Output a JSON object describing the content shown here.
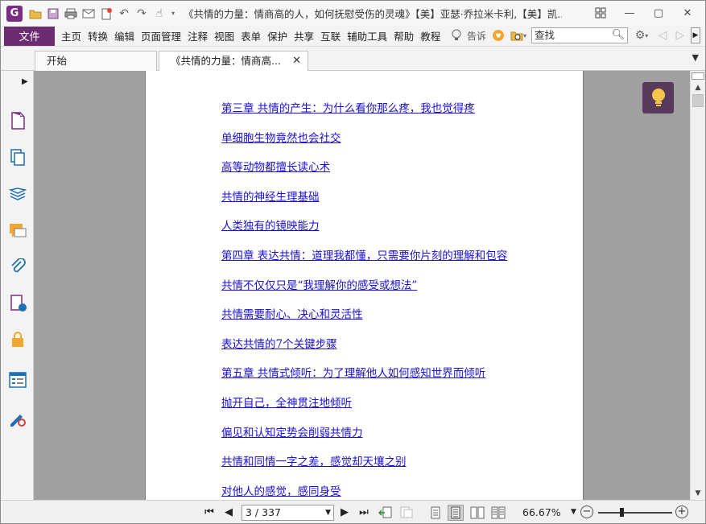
{
  "titlebar": {
    "title": "《共情的力量：情商高的人，如何抚慰受伤的灵魂》【美】亚瑟·乔拉米卡利,【美】凯...",
    "logo_letter": "G",
    "quick_access_icons": [
      "open-icon",
      "save-icon",
      "print-icon",
      "email-icon",
      "new-icon",
      "undo-icon",
      "redo-icon",
      "hand-tool-icon"
    ]
  },
  "menubar": {
    "file_label": "文件",
    "items": [
      "主页",
      "转换",
      "编辑",
      "页面管理",
      "注释",
      "视图",
      "表单",
      "保护",
      "共享",
      "互联",
      "辅助工具",
      "帮助",
      "教程"
    ],
    "tell_label": "告诉",
    "search_placeholder": "查找"
  },
  "tabs": [
    {
      "label": "开始",
      "active": false
    },
    {
      "label": "《共情的力量：情商高...",
      "active": true,
      "close": "✕"
    }
  ],
  "sidebar_icons": [
    "pages-icon",
    "thumbnails-icon",
    "layers-icon",
    "comments-icon",
    "attachments-icon",
    "signature-icon",
    "security-icon",
    "form-fields-icon",
    "certify-icon"
  ],
  "toc": [
    "第三章 共情的产生：为什么看你那么疼，我也觉得疼",
    "单细胞生物竟然也会社交",
    "高等动物都擅长读心术",
    "共情的神经生理基础",
    "人类独有的镜映能力",
    "第四章 表达共情：道理我都懂，只需要你片刻的理解和包容",
    "共情不仅仅只是“我理解你的感受或想法”",
    "共情需要耐心、决心和灵活性",
    "表达共情的7个关键步骤",
    "第五章 共情式倾听：为了理解他人如何感知世界而倾听",
    "抛开自己，全神贯注地倾听",
    "偏见和认知定势会削弱共情力",
    "共情和同情一字之差，感觉却天壤之别",
    "对他人的感觉，感同身受"
  ],
  "status": {
    "page_display": "3 / 337",
    "zoom": "66.67%"
  },
  "colors": {
    "brand": "#6b2c70",
    "link": "#1a0fd8",
    "canvas": "#a0a0a0"
  }
}
